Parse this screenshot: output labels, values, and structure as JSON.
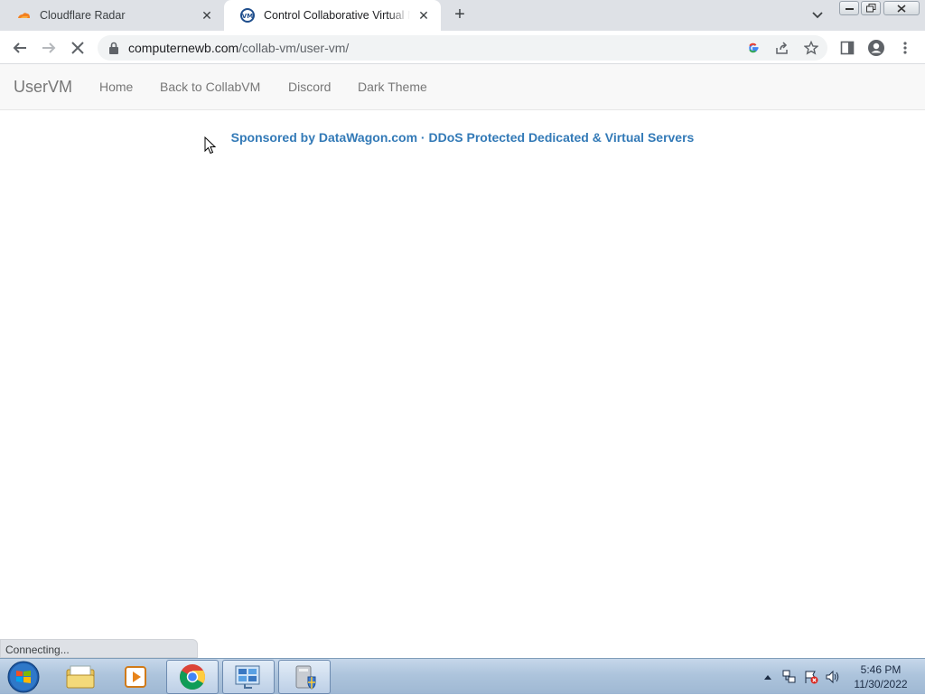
{
  "browser": {
    "tabs": [
      {
        "title": "Cloudflare Radar",
        "active": false,
        "favicon": "cloudflare-icon"
      },
      {
        "title": "Control Collaborative Virtual Machines",
        "active": true,
        "favicon": "collabvm-icon"
      }
    ],
    "new_tab_label": "+",
    "address": {
      "host": "computernewb.com",
      "path": "/collab-vm/user-vm/"
    },
    "status_text": "Connecting..."
  },
  "page": {
    "brand": "UserVM",
    "nav": [
      {
        "label": "Home"
      },
      {
        "label": "Back to CollabVM"
      },
      {
        "label": "Discord"
      },
      {
        "label": "Dark Theme"
      }
    ],
    "sponsor_text": "Sponsored by DataWagon.com · DDoS Protected Dedicated & Virtual Servers",
    "link_color": "#337ab7"
  },
  "taskbar": {
    "time": "5:46 PM",
    "date": "11/30/2022",
    "pinned": [
      "file-explorer-icon",
      "media-player-icon",
      "chrome-icon",
      "control-panel-icon",
      "security-icon"
    ]
  }
}
